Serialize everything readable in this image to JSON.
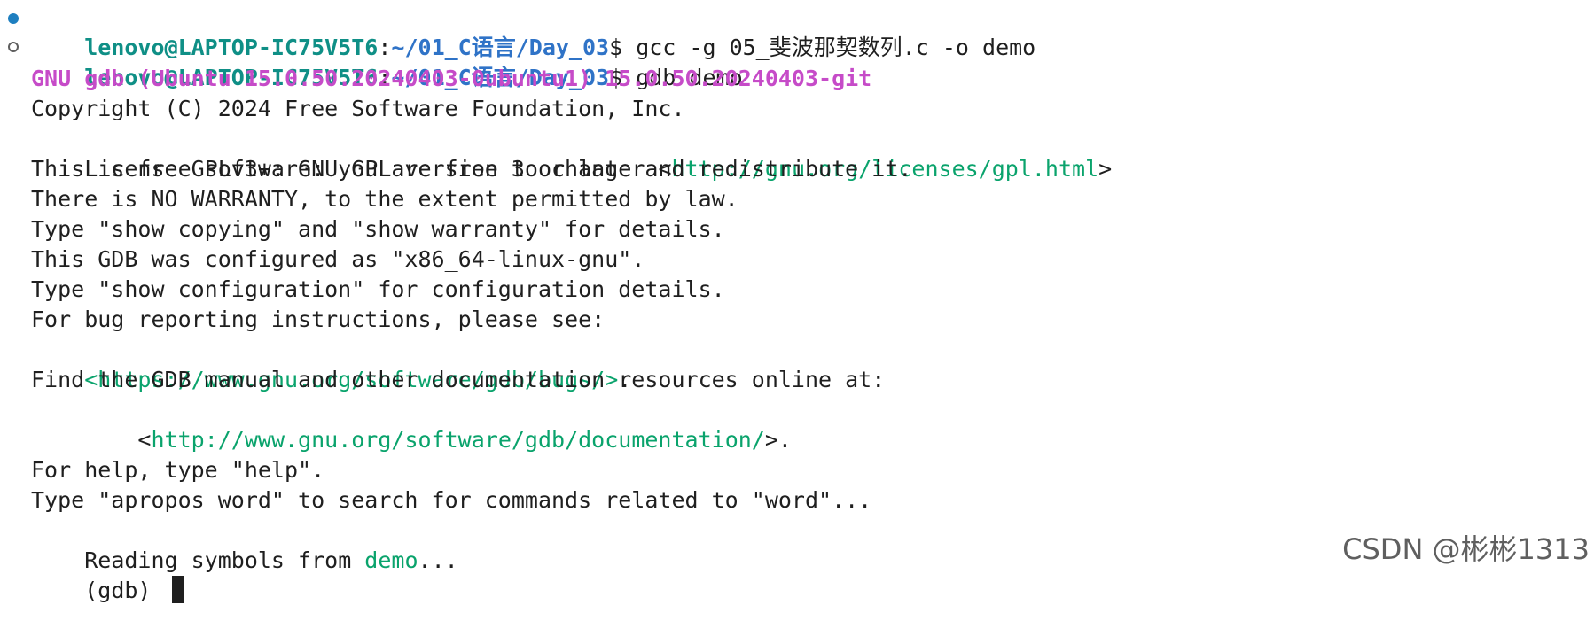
{
  "terminal": {
    "lines": [
      {
        "user": "lenovo@LAPTOP-IC75V5T6",
        "colon": ":",
        "path": "~/01_C语言/Day_03",
        "dollar": "$",
        "command": " gcc -g 05_斐波那契数列.c -o demo"
      },
      {
        "user": "lenovo@LAPTOP-IC75V5T6",
        "colon": ":",
        "path": "~/01_C语言/Day_03",
        "dollar": "$",
        "command": " gdb demo"
      }
    ],
    "output": {
      "title": "GNU gdb (Ubuntu 15.0.50.20240403-0ubuntu1) 15.0.50.20240403-git",
      "copyright": "Copyright (C) 2024 Free Software Foundation, Inc.",
      "license_prefix": "License GPLv3+: GNU GPL version 3 or later ",
      "license_link_open": "<",
      "license_url": "http://gnu.org/licenses/gpl.html",
      "license_link_close": ">",
      "free_software": "This is free software: you are free to change and redistribute it.",
      "warranty": "There is NO WARRANTY, to the extent permitted by law.",
      "show_copying": "Type \"show copying\" and \"show warranty\" for details.",
      "configured": "This GDB was configured as \"x86_64-linux-gnu\".",
      "show_configuration": "Type \"show configuration\" for configuration details.",
      "bug_reporting": "For bug reporting instructions, please see:",
      "bugs_url": "<https://www.gnu.org/software/gdb/bugs/>",
      "bugs_suffix": ".",
      "manual": "Find the GDB manual and other documentation resources online at:",
      "doc_indent": "    <",
      "doc_url": "http://www.gnu.org/software/gdb/documentation/",
      "doc_suffix": ">.",
      "help": "For help, type \"help\".",
      "apropos": "Type \"apropos word\" to search for commands related to \"word\"...",
      "reading_prefix": "Reading symbols from ",
      "reading_symbol": "demo",
      "reading_suffix": "...",
      "gdb_prompt": "(gdb) "
    }
  },
  "watermark": {
    "text": "CSDN @彬彬1313"
  },
  "colors": {
    "background": "#ffffff",
    "text": "#1f1f1f",
    "user": "#0f8f86",
    "path": "#2f73c7",
    "gnu_title": "#c64bc8",
    "link": "#0aa36c",
    "watermark": "#5f5f5f"
  }
}
